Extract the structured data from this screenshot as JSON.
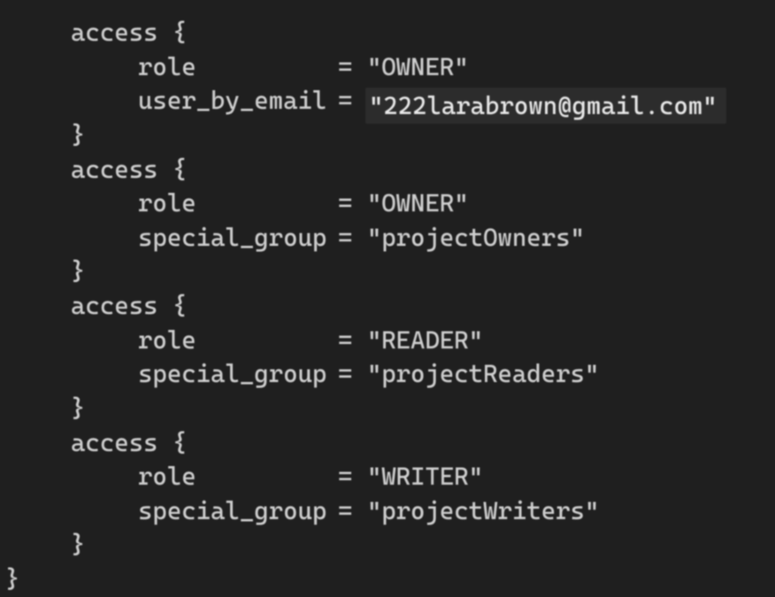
{
  "blocks": [
    {
      "header": "access {",
      "fields": [
        {
          "key": "role",
          "value": "\"OWNER\"",
          "highlight": false
        },
        {
          "key": "user_by_email",
          "value": "\"222larabrown@gmail.com\"",
          "highlight": true
        }
      ],
      "footer": "}"
    },
    {
      "header": "access {",
      "fields": [
        {
          "key": "role",
          "value": "\"OWNER\"",
          "highlight": false
        },
        {
          "key": "special_group",
          "value": "\"projectOwners\"",
          "highlight": false
        }
      ],
      "footer": "}"
    },
    {
      "header": "access {",
      "fields": [
        {
          "key": "role",
          "value": "\"READER\"",
          "highlight": false
        },
        {
          "key": "special_group",
          "value": "\"projectReaders\"",
          "highlight": false
        }
      ],
      "footer": "}"
    },
    {
      "header": "access {",
      "fields": [
        {
          "key": "role",
          "value": "\"WRITER\"",
          "highlight": false
        },
        {
          "key": "special_group",
          "value": "\"projectWriters\"",
          "highlight": false
        }
      ],
      "footer": "}"
    }
  ],
  "closing_brace": "}"
}
